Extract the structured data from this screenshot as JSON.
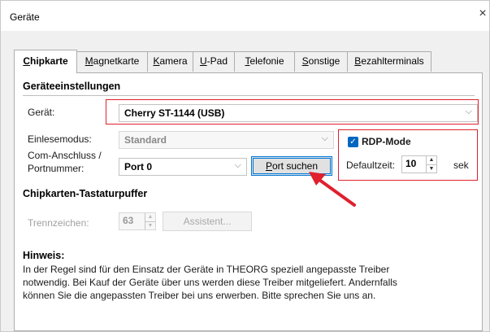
{
  "window": {
    "title": "Geräte",
    "close_icon": "×"
  },
  "tabs": [
    {
      "pre": "",
      "u": "C",
      "post": "hipkarte"
    },
    {
      "pre": "",
      "u": "M",
      "post": "agnetkarte"
    },
    {
      "pre": "",
      "u": "K",
      "post": "amera"
    },
    {
      "pre": "",
      "u": "U",
      "post": "-Pad"
    },
    {
      "pre": "",
      "u": "T",
      "post": "elefonie"
    },
    {
      "pre": "",
      "u": "S",
      "post": "onstige"
    },
    {
      "pre": "",
      "u": "B",
      "post": "ezahlterminals"
    }
  ],
  "settings": {
    "heading": "Geräteeinstellungen",
    "device_label": "Gerät:",
    "device_value": "Cherry ST-1144 (USB)",
    "read_mode_label": "Einlesemodus:",
    "read_mode_value": "Standard",
    "com_label_1": "Com-Anschluss /",
    "com_label_2": "Portnummer:",
    "port_value": "Port 0",
    "port_search_button": {
      "pre": "",
      "u": "P",
      "post": "ort suchen"
    }
  },
  "rdp": {
    "checkbox_label": "RDP-Mode",
    "checked": true,
    "default_time_label": "Defaultzeit:",
    "default_time_value": "10",
    "unit": "sek"
  },
  "buffer": {
    "heading": "Chipkarten-Tastaturpuffer",
    "separator_label": "Trennzeichen:",
    "separator_value": "63",
    "assistant_button": "Assistent..."
  },
  "hint": {
    "heading": "Hinweis:",
    "line_1": "In der Regel sind für den Einsatz der Geräte in THEORG speziell angepasste Treiber",
    "line_2": "notwendig. Bei Kauf der Geräte über uns werden diese Treiber mitgeliefert. Andernfalls",
    "line_3": "können Sie die angepassten Treiber bei uns erwerben. Bitte sprechen Sie uns an."
  },
  "icons": {
    "chevron": "chevron-down-icon",
    "spin_up": "spin-up-icon",
    "spin_down": "spin-down-icon",
    "annotation_arrow": "red-arrow-annotation"
  },
  "colors": {
    "accent": "#0067c0",
    "annotation_red": "#e0202d"
  }
}
